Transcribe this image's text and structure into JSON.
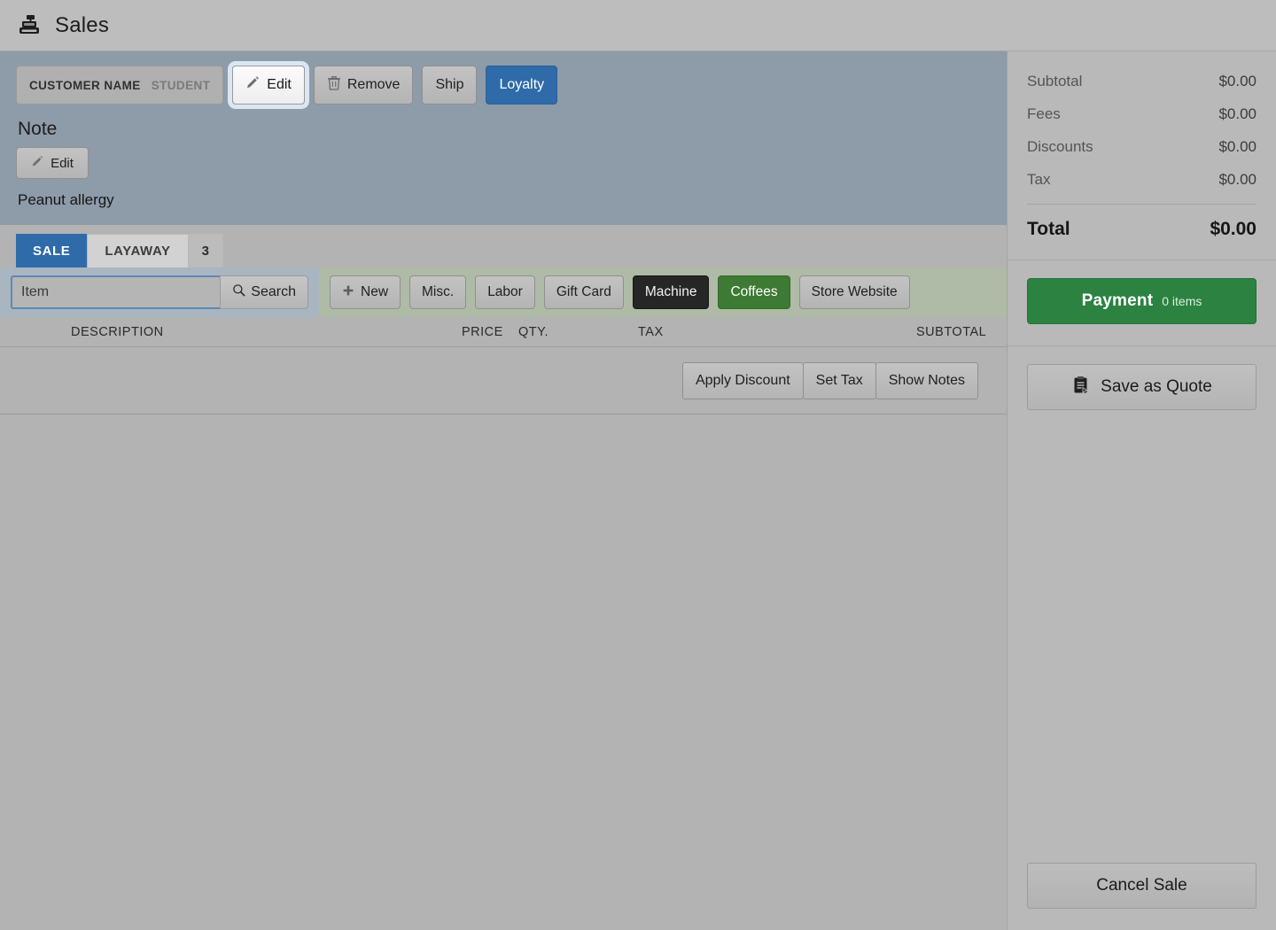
{
  "window": {
    "title": "Sales",
    "icon": "cash-register-icon"
  },
  "customer": {
    "label": "CUSTOMER NAME",
    "value": "STUDENT",
    "edit_label": "Edit",
    "edit_icon": "pencil-icon",
    "remove_label": "Remove",
    "remove_icon": "trash-icon",
    "ship_label": "Ship",
    "loyalty_label": "Loyalty"
  },
  "note": {
    "heading": "Note",
    "edit_label": "Edit",
    "edit_icon": "pencil-icon",
    "text": "Peanut allergy"
  },
  "tabs": [
    {
      "label": "SALE",
      "active": true,
      "count": ""
    },
    {
      "label": "LAYAWAY",
      "active": false,
      "count": "3"
    }
  ],
  "search": {
    "placeholder": "Item",
    "value": "",
    "button_label": "Search",
    "button_icon": "magnifier-icon"
  },
  "categories": [
    {
      "label": "New",
      "icon": "plus-icon",
      "style": "default"
    },
    {
      "label": "Misc.",
      "icon": "",
      "style": "default"
    },
    {
      "label": "Labor",
      "icon": "",
      "style": "default"
    },
    {
      "label": "Gift Card",
      "icon": "",
      "style": "default"
    },
    {
      "label": "Machine",
      "icon": "",
      "style": "dark"
    },
    {
      "label": "Coffees",
      "icon": "",
      "style": "green"
    },
    {
      "label": "Store Website",
      "icon": "",
      "style": "default"
    }
  ],
  "table": {
    "columns": [
      "DESCRIPTION",
      "PRICE",
      "QTY.",
      "TAX",
      "SUBTOTAL"
    ],
    "rows": []
  },
  "item_actions": [
    {
      "label": "Apply Discount"
    },
    {
      "label": "Set Tax"
    },
    {
      "label": "Show Notes"
    }
  ],
  "totals": {
    "lines": [
      {
        "label": "Subtotal",
        "value": "$0.00"
      },
      {
        "label": "Fees",
        "value": "$0.00"
      },
      {
        "label": "Discounts",
        "value": "$0.00"
      },
      {
        "label": "Tax",
        "value": "$0.00"
      }
    ],
    "grand_label": "Total",
    "grand_value": "$0.00"
  },
  "actions": {
    "payment_label": "Payment",
    "payment_items": "0 items",
    "quote_label": "Save as Quote",
    "quote_icon": "quote-clipboard-icon",
    "cancel_label": "Cancel Sale"
  },
  "colors": {
    "accent_blue": "#2e6ba8",
    "payment_green": "#2b8241",
    "category_green": "#3d7a33",
    "category_dark": "#262626",
    "customer_panel": "#8e9ba9",
    "category_panel": "#afbba6",
    "search_panel": "#a9b5c0",
    "app_bg": "#b3b3b3"
  }
}
